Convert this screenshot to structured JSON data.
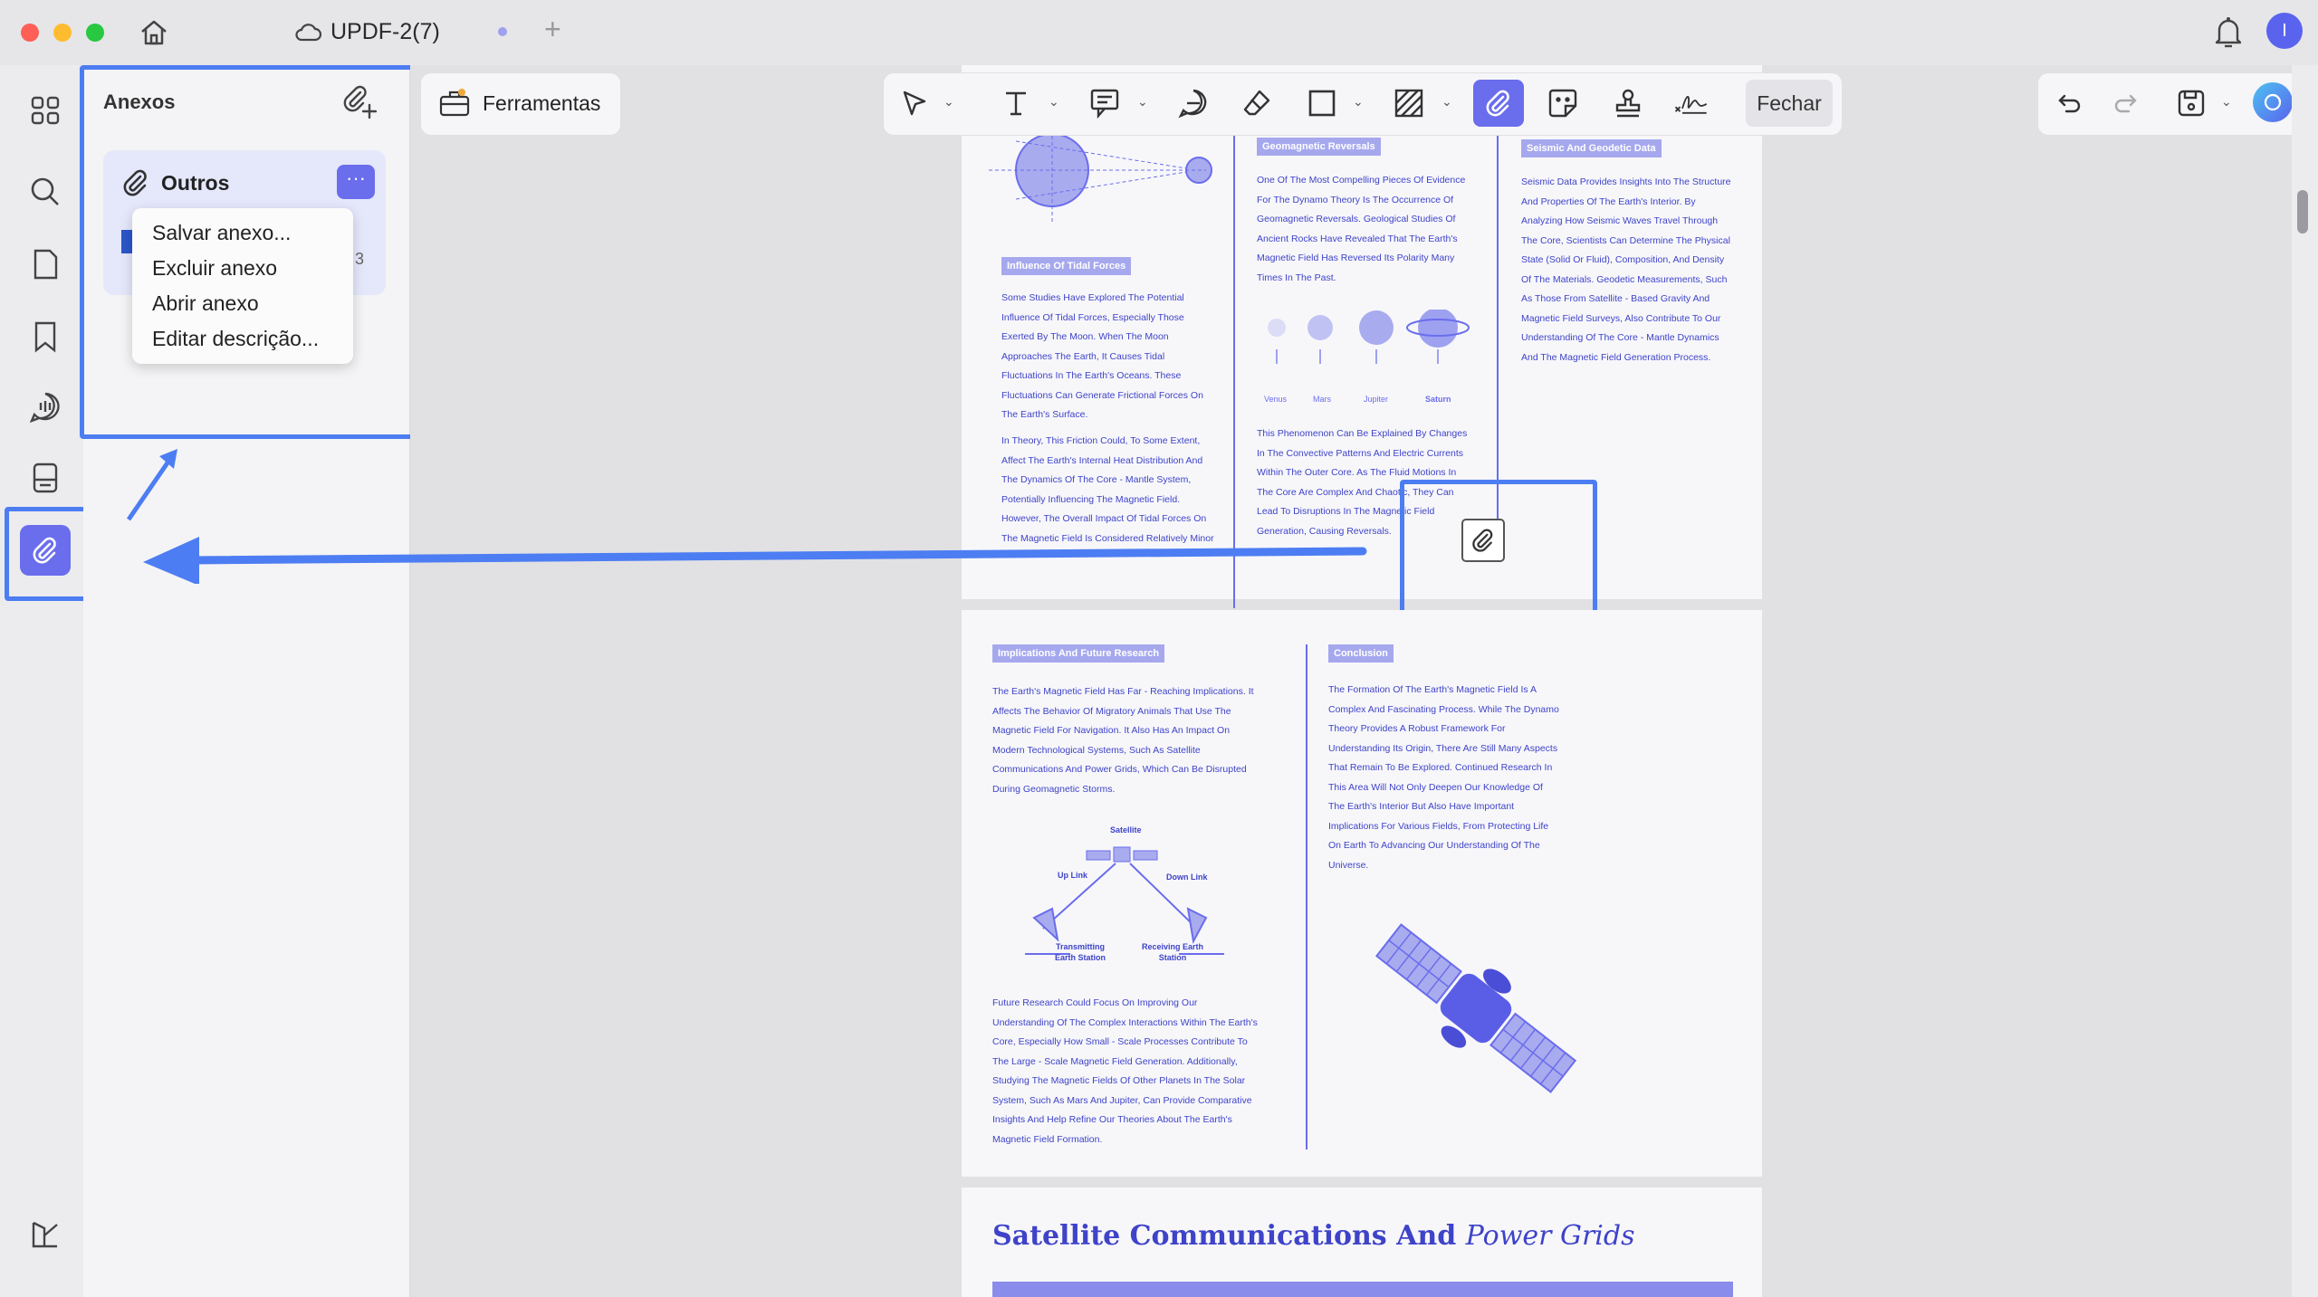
{
  "window": {
    "tab_title": "UPDF-2(7)"
  },
  "attachments_panel": {
    "title": "Anexos",
    "group_label": "Outros",
    "more_label": "···",
    "partial_item_number": "3",
    "context_menu": [
      "Salvar anexo...",
      "Excluir anexo",
      "Abrir anexo",
      "Editar descrição..."
    ]
  },
  "toolbar": {
    "tools_label": "Ferramentas",
    "close_label": "Fechar"
  },
  "user": {
    "avatar_initial": "I"
  },
  "document": {
    "page1": {
      "sec_tidal": "Influence Of Tidal Forces",
      "tidal_p1": "Some Studies Have Explored The Potential Influence Of Tidal Forces, Especially Those Exerted By The Moon. When The Moon Approaches The Earth, It Causes Tidal Fluctuations In The Earth's Oceans. These Fluctuations Can Generate Frictional Forces On The Earth's Surface.",
      "tidal_p2": "In Theory, This Friction Could, To Some Extent, Affect The Earth's Internal Heat Distribution And The Dynamics Of The Core - Mantle System, Potentially Influencing The Magnetic Field. However, The Overall Impact Of Tidal Forces On The Magnetic Field Is Considered Relatively Minor",
      "sec_geo": "Geomagnetic Reversals",
      "geo_p1": "One Of The Most Compelling Pieces Of Evidence For The Dynamo Theory Is The Occurrence Of Geomagnetic Reversals. Geological Studies Of Ancient Rocks Have Revealed That The Earth's Magnetic Field Has Reversed Its Polarity Many Times In The Past.",
      "planets": [
        "Venus",
        "Mars",
        "Jupiter",
        "Saturn"
      ],
      "geo_p2": "This Phenomenon Can Be Explained By Changes In The Convective Patterns And Electric Currents Within The Outer Core. As The Fluid Motions In The Core Are Complex And Chaotic, They Can Lead To Disruptions In The Magnetic Field Generation, Causing Reversals.",
      "sec_seismic": "Seismic And Geodetic Data",
      "seismic_p1": "Seismic Data Provides Insights Into The Structure And Properties Of The Earth's Interior. By Analyzing How Seismic Waves Travel Through The Core, Scientists Can Determine The Physical State (Solid Or Fluid), Composition, And Density Of The Materials. Geodetic Measurements, Such As Those From Satellite - Based Gravity And Magnetic Field Surveys, Also Contribute To Our Understanding Of The Core - Mantle Dynamics And The Magnetic Field Generation Process."
    },
    "page2": {
      "sec_impl": "Implications And Future Research",
      "impl_p1": "The Earth's Magnetic Field Has Far - Reaching Implications. It Affects The Behavior Of Migratory Animals That Use The Magnetic Field For Navigation. It Also Has An Impact On Modern Technological Systems, Such As Satellite Communications And Power Grids, Which Can Be Disrupted During Geomagnetic Storms.",
      "diagram": {
        "satellite": "Satellite",
        "up_link": "Up Link",
        "down_link": "Down Link",
        "tx": "Transmitting Earth Station",
        "rx": "Receiving Earth Station"
      },
      "impl_p2": "Future Research Could Focus On Improving Our Understanding Of The Complex Interactions Within The Earth's Core, Especially How Small - Scale Processes Contribute To The Large - Scale Magnetic Field Generation. Additionally, Studying The Magnetic Fields Of Other Planets In The Solar System, Such As Mars And Jupiter, Can Provide Comparative Insights And Help Refine Our Theories About The Earth's Magnetic Field Formation.",
      "sec_conc": "Conclusion",
      "conc_p1": "The Formation Of The Earth's Magnetic Field Is A Complex And Fascinating Process. While The Dynamo Theory Provides A Robust Framework For Understanding Its Origin, There Are Still Many Aspects That Remain To Be Explored. Continued Research In This Area Will Not Only Deepen Our Knowledge Of The Earth's Interior But Also Have Important Implications For Various Fields, From Protecting Life On Earth To Advancing Our Understanding Of The Universe."
    },
    "page3": {
      "heading_main": "Satellite Communications And ",
      "heading_italic": "Power Grids"
    }
  },
  "colors": {
    "accent": "#6a6dec",
    "highlight_blue": "#4d7df2",
    "doc_text": "#3e43c8"
  }
}
